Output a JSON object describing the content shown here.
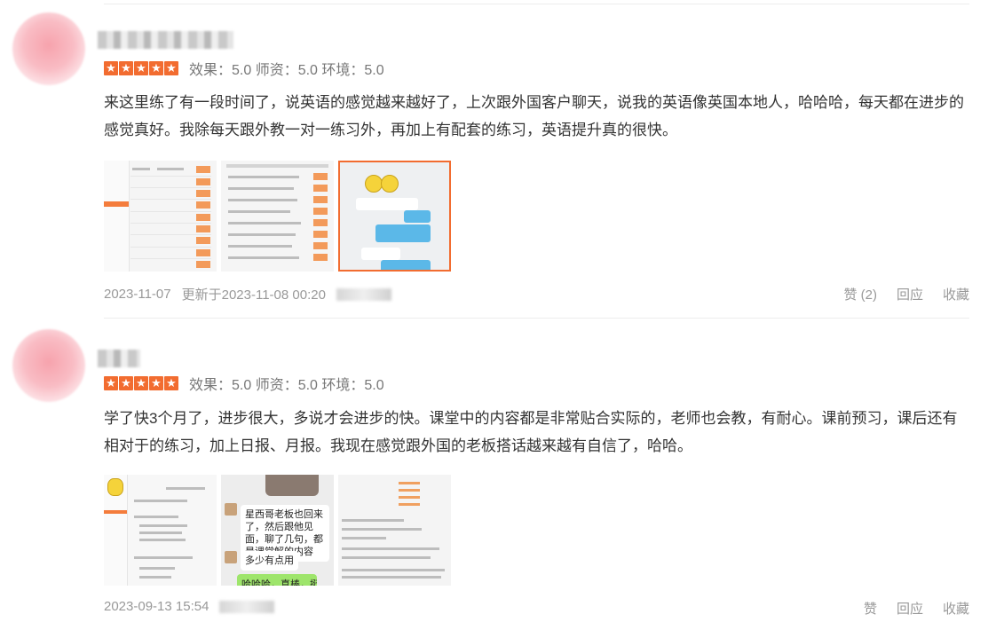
{
  "reviews": [
    {
      "rating_scores": "效果：5.0  师资：5.0  环境：5.0",
      "stars": 5,
      "content": "来这里练了有一段时间了，说英语的感觉越来越好了，上次跟外国客户聊天，说我的英语像英国本地人，哈哈哈，每天都在进步的感觉真好。我除每天跟外教一对一练习外，再加上有配套的练习，英语提升真的很快。",
      "date": "2023-11-07",
      "updated": "更新于2023-11-08 00:20",
      "actions": {
        "like": "赞 (2)",
        "reply": "回应",
        "collect": "收藏"
      }
    },
    {
      "rating_scores": "效果：5.0  师资：5.0  环境：5.0",
      "stars": 5,
      "content": "学了快3个月了，进步很大，多说才会进步的快。课堂中的内容都是非常贴合实际的，老师也会教，有耐心。课前预习，课后还有相对于的练习，加上日报、月报。我现在感觉跟外国的老板搭话越来越有自信了，哈哈。",
      "date": "2023-09-13 15:54",
      "actions": {
        "like": "赞",
        "reply": "回应",
        "collect": "收藏"
      },
      "thumb_text": {
        "bubble1": "星西哥老板也回来了，然后跟他见面，聊了几句，都是课堂解的内容",
        "bubble2": "多少有点用",
        "bubble3": "哈哈哈，真棒，挺好几个"
      }
    }
  ],
  "colors": {
    "accent": "#f26c30",
    "text": "#333333",
    "muted": "#999999"
  },
  "icons": {
    "star": "star-icon"
  }
}
